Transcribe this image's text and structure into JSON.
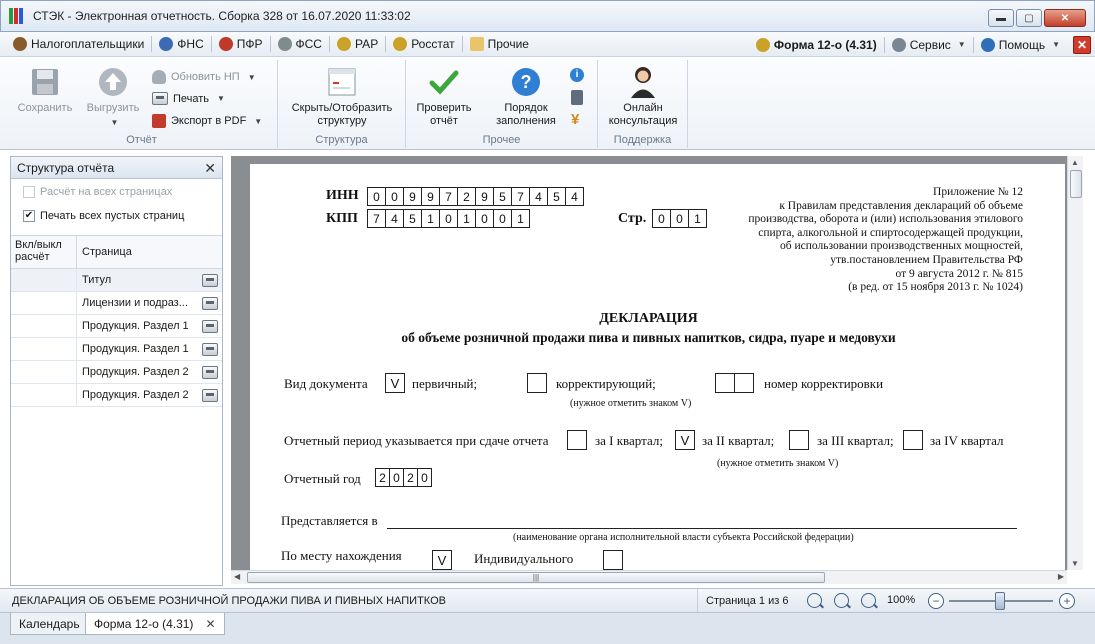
{
  "window": {
    "title": "СТЭК - Электронная отчетность. Сборка 328 от 16.07.2020 11:33:02",
    "minimize": "▬",
    "maximize": "▢",
    "close": "✕",
    "icon_colors": [
      "#2a9d3a",
      "#d62b2b",
      "#2a5bd6"
    ]
  },
  "menu": {
    "items": [
      {
        "label": "Налогоплательщики",
        "color": "#8b5a2b"
      },
      {
        "label": "ФНС",
        "color": "#3d6bb3"
      },
      {
        "label": "ПФР",
        "color": "#c0392b"
      },
      {
        "label": "ФСС",
        "color": "#7f8c8d"
      },
      {
        "label": "РАР",
        "color": "#c9a227"
      },
      {
        "label": "Росстат",
        "color": "#c9a227"
      },
      {
        "label": "Прочие",
        "color": "#e9c46a"
      }
    ],
    "form": "Форма 12-о (4.31)",
    "service": "Сервис",
    "help": "Помощь",
    "close": "✕"
  },
  "ribbon": {
    "save": "Сохранить",
    "upload": "Выгрузить",
    "update_np": "Обновить НП",
    "print": "Печать",
    "export_pdf": "Экспорт в PDF",
    "group_report": "Отчёт",
    "toggle_structure": "Скрыть/Отобразить структуру",
    "group_structure": "Структура",
    "check": "Проверить отчёт",
    "order": "Порядок заполнения",
    "group_other": "Прочее",
    "online": "Онлайн консультация",
    "group_support": "Поддержка"
  },
  "structure_panel": {
    "title": "Структура отчёта",
    "close": "✕",
    "calc_all": "Расчёт на всех страницах",
    "print_empty": "Печать всех пустых страниц",
    "print_empty_checked": "✔",
    "col_toggle": "Вкл/выкл расчёт",
    "col_page": "Страница",
    "rows": [
      "Титул",
      "Лицензии и подраз...",
      "Продукция. Раздел 1",
      "Продукция. Раздел 1",
      "Продукция. Раздел 2",
      "Продукция. Раздел 2"
    ]
  },
  "document": {
    "inn_label": "ИНН",
    "inn": [
      "0",
      "0",
      "9",
      "9",
      "7",
      "2",
      "9",
      "5",
      "7",
      "4",
      "5",
      "4"
    ],
    "kpp_label": "КПП",
    "kpp": [
      "7",
      "4",
      "5",
      "1",
      "0",
      "1",
      "0",
      "0",
      "1"
    ],
    "page_label": "Стр.",
    "page": [
      "0",
      "0",
      "1"
    ],
    "appendix": [
      "Приложение № 12",
      "к Правилам представления деклараций об объеме",
      "производства, оборота и (или) использования этилового",
      "спирта, алкогольной и спиртосодержащей продукции,",
      "об использовании производственных мощностей,",
      "утв.постановлением Правительства РФ",
      "от 9 августа 2012 г. № 815",
      "(в ред. от 15 ноября 2013 г. № 1024)"
    ],
    "title": "ДЕКЛАРАЦИЯ",
    "subtitle": "об объеме розничной продажи пива и пивных напитков, сидра, пуаре и медовухи",
    "doc_type_label": "Вид документа",
    "primary_mark": "V",
    "primary": "первичный;",
    "corrective": "корректирующий;",
    "correction_number": "номер корректировки",
    "mark_note": "(нужное отметить знаком V)",
    "period_label": "Отчетный период указывается при сдаче отчета",
    "q1": "за I квартал;",
    "q2_mark": "V",
    "q2": "за II квартал;",
    "q3": "за III квартал;",
    "q4": "за IV квартал",
    "period_note": "(нужное отметить знаком V)",
    "year_label": "Отчетный год",
    "year": [
      "2",
      "0",
      "2",
      "0"
    ],
    "submitted_to": "Представляется в",
    "submitted_note": "(наименование органа исполнительной власти субъекта Российской федерации)",
    "location_label": "По месту нахождения",
    "location_mark": "V",
    "individual": "Индивидуального"
  },
  "statusbar": {
    "doc_name": "ДЕКЛАРАЦИЯ ОБ ОБЪЕМЕ РОЗНИЧНОЙ ПРОДАЖИ ПИВА И ПИВНЫХ НАПИТКОВ",
    "page_info": "Страница 1 из 6",
    "zoom": "100%",
    "zoom_minus": "−",
    "zoom_plus": "+",
    "zoom_fraction": 0.5
  },
  "tabs": [
    {
      "label": "Календарь"
    },
    {
      "label": "Форма 12-о (4.31)",
      "close": "✕"
    }
  ]
}
